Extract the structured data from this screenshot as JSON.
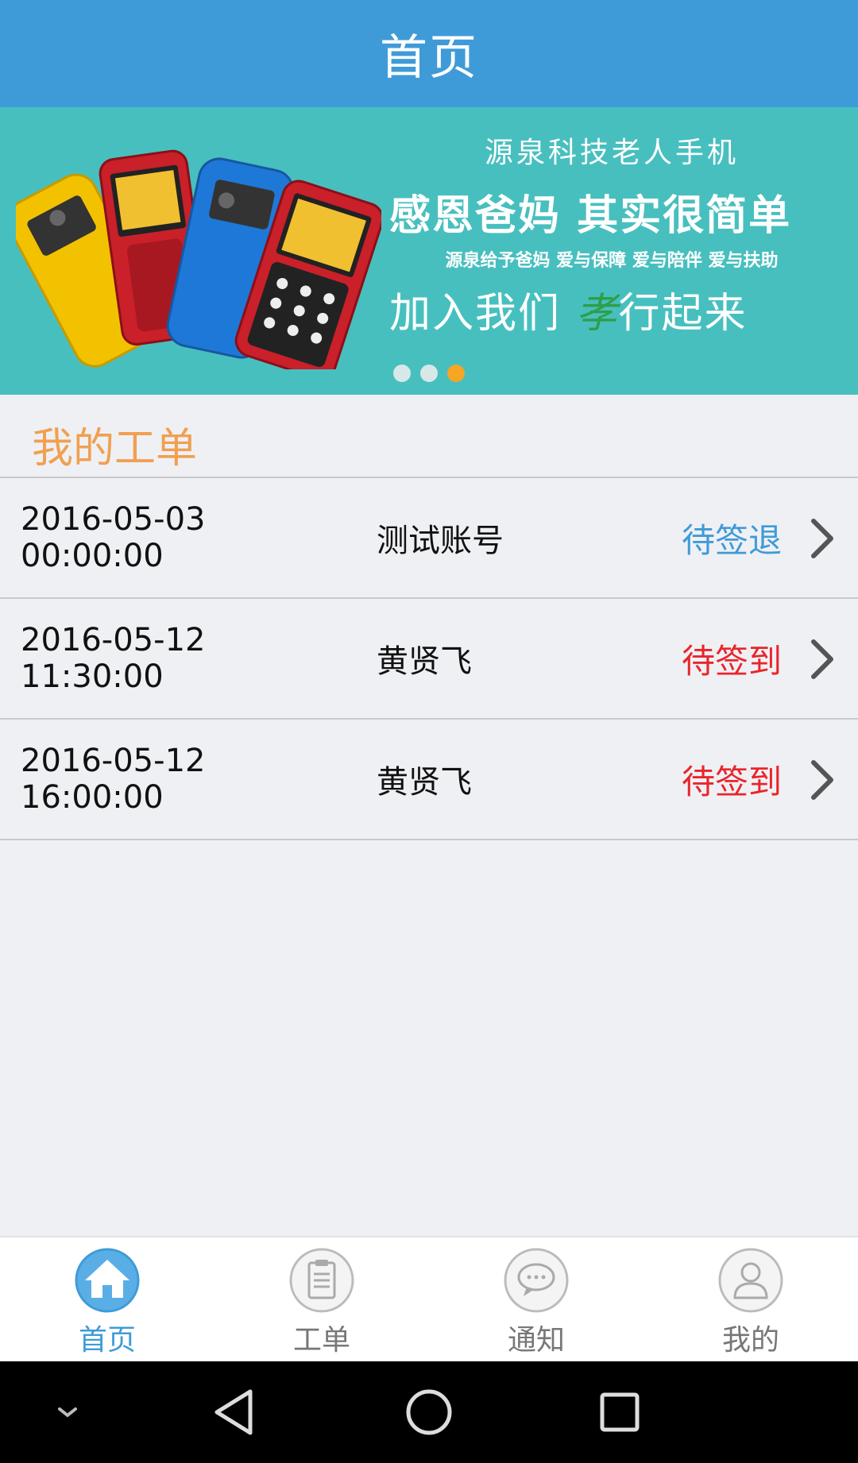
{
  "header": {
    "title": "首页"
  },
  "banner": {
    "line1": "源泉科技老人手机",
    "line2": "感恩爸妈  其实很简单",
    "line3": "源泉给予爸妈  爱与保障  爱与陪伴  爱与扶助",
    "line4_a": "加入我们  ",
    "line4_b": "孝",
    "line4_c": "行起来",
    "dots_total": 3,
    "dots_active_index": 2
  },
  "section": {
    "title": "我的工单"
  },
  "orders": [
    {
      "datetime": "2016-05-03 00:00:00",
      "name": "测试账号",
      "status": "待签退",
      "status_color": "#3f9bd8"
    },
    {
      "datetime": "2016-05-12 11:30:00",
      "name": "黄贤飞",
      "status": "待签到",
      "status_color": "#e8262b"
    },
    {
      "datetime": "2016-05-12 16:00:00",
      "name": "黄贤飞",
      "status": "待签到",
      "status_color": "#e8262b"
    }
  ],
  "tabbar": {
    "tabs": [
      {
        "label": "首页",
        "icon": "home-icon",
        "active": true
      },
      {
        "label": "工单",
        "icon": "clipboard-icon",
        "active": false
      },
      {
        "label": "通知",
        "icon": "chat-icon",
        "active": false
      },
      {
        "label": "我的",
        "icon": "user-icon",
        "active": false
      }
    ]
  },
  "system_nav": {
    "icons": [
      "chevron-down-icon",
      "back-icon",
      "home-circle-icon",
      "recents-icon"
    ]
  },
  "colors": {
    "accent": "#3f9bd8",
    "section_title": "#f0a050",
    "banner_bg": "#48bfbf",
    "dot_active": "#f5a623"
  }
}
